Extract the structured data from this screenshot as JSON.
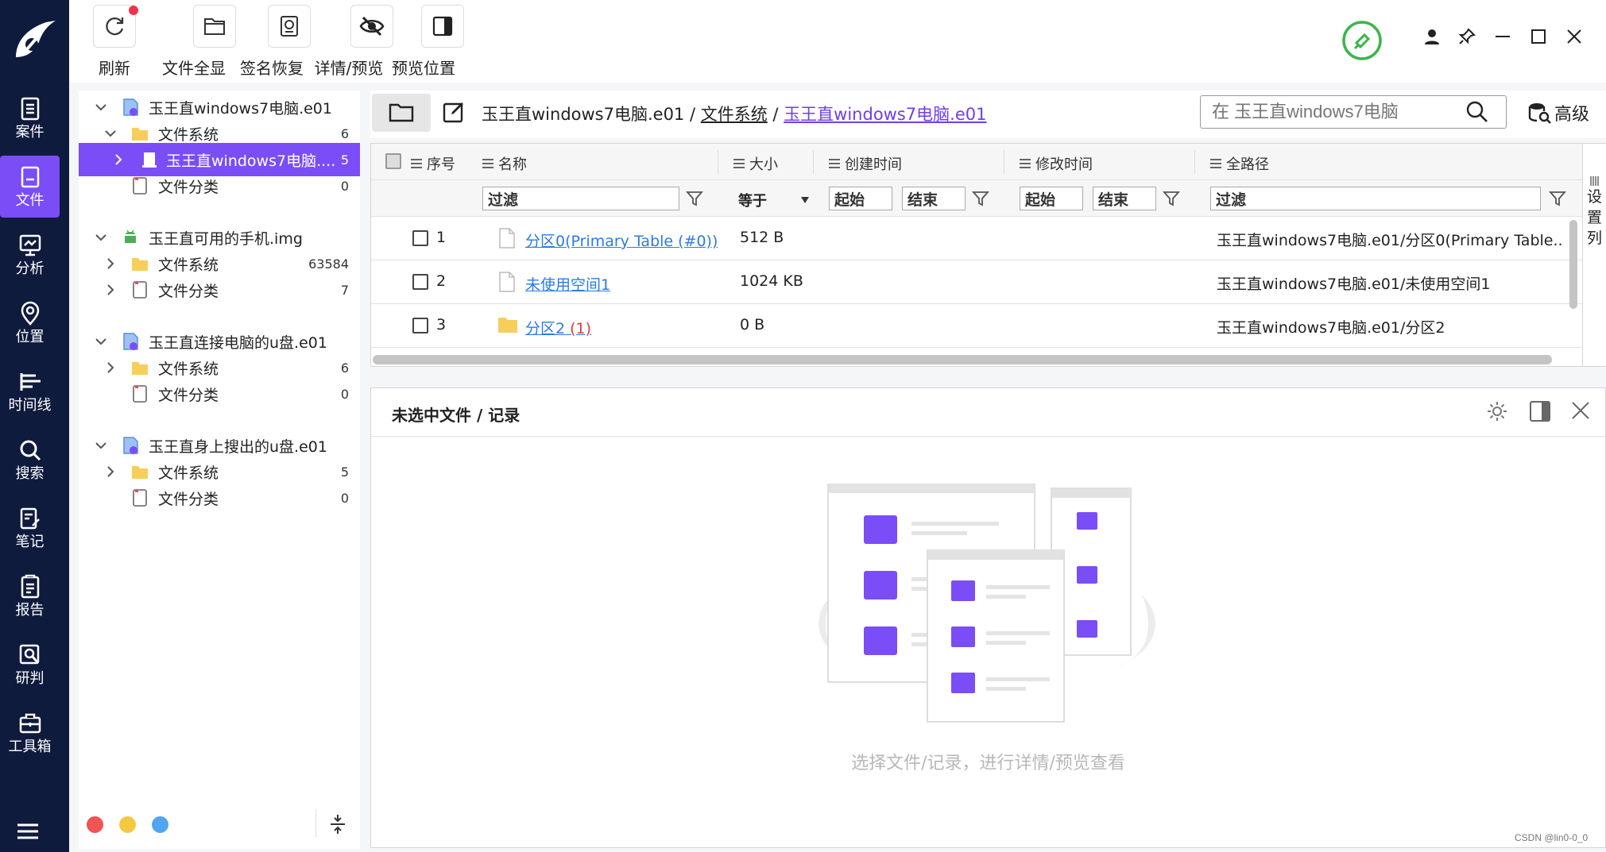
{
  "nav": {
    "items": [
      {
        "label": "案件",
        "icon": "case-icon"
      },
      {
        "label": "文件",
        "icon": "file-icon"
      },
      {
        "label": "分析",
        "icon": "analysis-icon"
      },
      {
        "label": "位置",
        "icon": "location-icon"
      },
      {
        "label": "时间线",
        "icon": "timeline-icon"
      },
      {
        "label": "搜索",
        "icon": "search-icon"
      },
      {
        "label": "笔记",
        "icon": "notes-icon"
      },
      {
        "label": "报告",
        "icon": "report-icon"
      },
      {
        "label": "研判",
        "icon": "judge-icon"
      },
      {
        "label": "工具箱",
        "icon": "toolbox-icon"
      }
    ],
    "active_index": 1
  },
  "toolbar": {
    "refresh": "刷新",
    "show_all": "文件全显",
    "sig_recover": "签名恢复",
    "detail_preview": "详情/预览",
    "preview_pos": "预览位置"
  },
  "tree": {
    "nodes": [
      {
        "label": "玉王直windows7电脑.e01",
        "count": "",
        "level": 0
      },
      {
        "label": "文件系统",
        "count": "6",
        "level": 1
      },
      {
        "label": "玉王直windows7电脑....",
        "count": "5",
        "level": 2,
        "selected": true
      },
      {
        "label": "文件分类",
        "count": "0",
        "level": 1
      },
      {
        "label": "玉王直可用的手机.img",
        "count": "",
        "level": 0
      },
      {
        "label": "文件系统",
        "count": "63584",
        "level": 1
      },
      {
        "label": "文件分类",
        "count": "7",
        "level": 1
      },
      {
        "label": "玉王直连接电脑的u盘.e01",
        "count": "",
        "level": 0
      },
      {
        "label": "文件系统",
        "count": "6",
        "level": 1
      },
      {
        "label": "文件分类",
        "count": "0",
        "level": 1
      },
      {
        "label": "玉王直身上搜出的u盘.e01",
        "count": "",
        "level": 0
      },
      {
        "label": "文件系统",
        "count": "5",
        "level": 1
      },
      {
        "label": "文件分类",
        "count": "0",
        "level": 1
      }
    ],
    "dot_colors": [
      "#f05454",
      "#f5c842",
      "#4ea6f2"
    ]
  },
  "pathbar": {
    "crumb1": "玉王直windows7电脑.e01",
    "sep": " / ",
    "crumb2": "文件系统",
    "crumb3": "玉王直windows7电脑.e01",
    "search_placeholder": "在 玉王直windows7电脑",
    "advanced": "高级"
  },
  "table": {
    "headers": {
      "num": "序号",
      "name": "名称",
      "size": "大小",
      "created": "创建时间",
      "modified": "修改时间",
      "path": "全路径"
    },
    "filters": {
      "name": "过滤",
      "size_op": "等于",
      "start": "起始",
      "end": "结束",
      "path": "过滤"
    },
    "rows": [
      {
        "num": "1",
        "name": "分区0(Primary Table (#0))",
        "size": "512 B",
        "path": "玉王直windows7电脑.e01/分区0(Primary Table.."
      },
      {
        "num": "2",
        "name": "未使用空间1",
        "size": "1024 KB",
        "path": "玉王直windows7电脑.e01/未使用空间1"
      },
      {
        "num": "3",
        "name": "分区2",
        "name_badge": "(1)",
        "size": "0 B",
        "path": "玉王直windows7电脑.e01/分区2"
      }
    ],
    "column_settings": [
      "设",
      "置",
      "列"
    ]
  },
  "detail": {
    "title": "未选中文件 / 记录",
    "empty_text": "选择文件/记录，进行详情/预览查看"
  },
  "watermark": "CSDN @lin0-0_0",
  "colors": {
    "nav_bg": "#0f1b3d",
    "accent": "#7a4df6",
    "link": "#2a7be4",
    "status_green": "#3bb54a"
  }
}
